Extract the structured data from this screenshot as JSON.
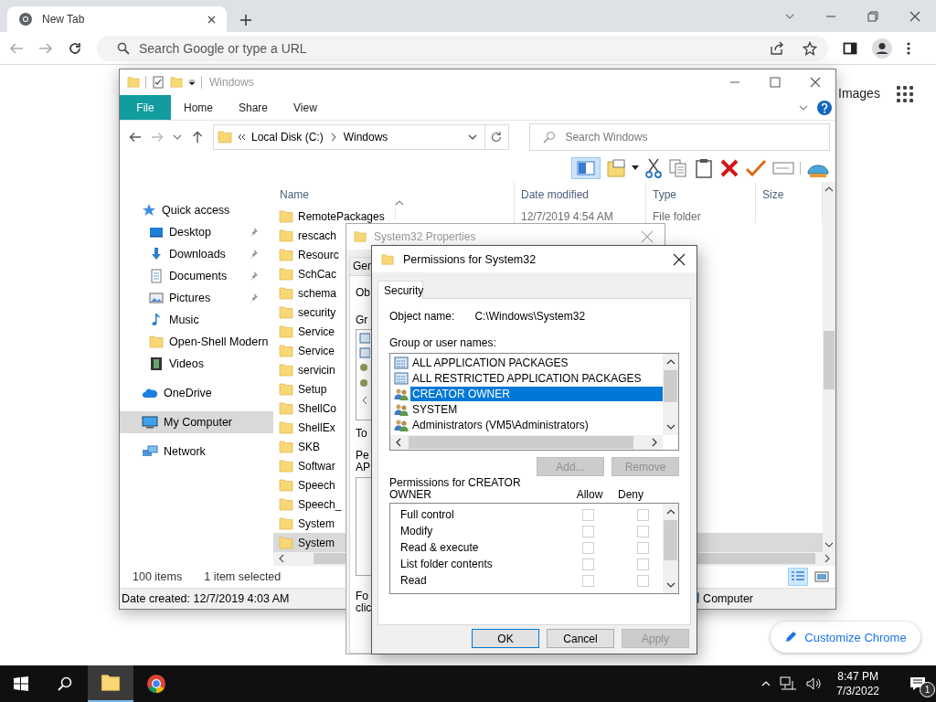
{
  "browser": {
    "tab": {
      "title": "New Tab"
    },
    "omnibox": {
      "placeholder": "Search Google or type a URL"
    },
    "header_link": "Images",
    "customize_button": "Customize Chrome"
  },
  "explorer": {
    "title": "Windows",
    "ribbon_tabs": [
      {
        "label": "File",
        "kind": "file"
      },
      {
        "label": "Home",
        "kind": "tab"
      },
      {
        "label": "Share",
        "kind": "tab"
      },
      {
        "label": "View",
        "kind": "tab"
      }
    ],
    "breadcrumb": [
      "Local Disk (C:)",
      "Windows"
    ],
    "search": {
      "placeholder": "Search Windows"
    },
    "nav": [
      {
        "label": "Quick access",
        "kind": "star",
        "pinned": false,
        "selected": false
      },
      {
        "label": "Desktop",
        "kind": "desktop",
        "pinned": true,
        "selected": false
      },
      {
        "label": "Downloads",
        "kind": "download",
        "pinned": true,
        "selected": false
      },
      {
        "label": "Documents",
        "kind": "document",
        "pinned": true,
        "selected": false
      },
      {
        "label": "Pictures",
        "kind": "picture",
        "pinned": true,
        "selected": false
      },
      {
        "label": "Music",
        "kind": "music",
        "pinned": false,
        "selected": false
      },
      {
        "label": "Open-Shell Modern",
        "kind": "folder",
        "pinned": false,
        "selected": false
      },
      {
        "label": "Videos",
        "kind": "video",
        "pinned": false,
        "selected": false
      },
      {
        "label": "OneDrive",
        "kind": "cloud",
        "pinned": false,
        "selected": false
      },
      {
        "label": "My Computer",
        "kind": "computer",
        "pinned": false,
        "selected": true
      },
      {
        "label": "Network",
        "kind": "network",
        "pinned": false,
        "selected": false
      }
    ],
    "columns": [
      "Name",
      "Date modified",
      "Type",
      "Size"
    ],
    "rows": [
      {
        "name": "RemotePackages",
        "date": "12/7/2019 4:54 AM",
        "type": "File folder",
        "selected": false
      },
      {
        "name": "rescach",
        "selected": false
      },
      {
        "name": "Resourc",
        "selected": false
      },
      {
        "name": "SchCac",
        "selected": false
      },
      {
        "name": "schema",
        "selected": false
      },
      {
        "name": "security",
        "selected": false
      },
      {
        "name": "Service",
        "selected": false
      },
      {
        "name": "Service",
        "selected": false
      },
      {
        "name": "servicin",
        "selected": false
      },
      {
        "name": "Setup",
        "selected": false
      },
      {
        "name": "ShellCo",
        "selected": false
      },
      {
        "name": "ShellEx",
        "selected": false
      },
      {
        "name": "SKB",
        "selected": false
      },
      {
        "name": "Softwar",
        "selected": false
      },
      {
        "name": "Speech",
        "selected": false
      },
      {
        "name": "Speech_",
        "selected": false
      },
      {
        "name": "System",
        "selected": false
      },
      {
        "name": "System",
        "selected": true
      }
    ],
    "item_count": "100 items",
    "selection_count": "1 item selected",
    "details": {
      "date_created": "Date created: 12/7/2019 4:03 AM",
      "location": "Computer"
    }
  },
  "properties": {
    "title": "System32 Properties",
    "tab": "Gen",
    "object_label": "Ob",
    "group_label": "Gr",
    "to_label": "To",
    "perm_label": [
      "Pe",
      "AP"
    ],
    "footer_label": [
      "Fo",
      "clic"
    ]
  },
  "permissions": {
    "title": "Permissions for System32",
    "tab": "Security",
    "object_name_label": "Object name:",
    "object_name": "C:\\Windows\\System32",
    "group_label": "Group or user names:",
    "groups": [
      {
        "name": "ALL APPLICATION PACKAGES",
        "kind": "package",
        "selected": false
      },
      {
        "name": "ALL RESTRICTED APPLICATION PACKAGES",
        "kind": "package",
        "selected": false
      },
      {
        "name": "CREATOR OWNER",
        "kind": "users",
        "selected": true
      },
      {
        "name": "SYSTEM",
        "kind": "users",
        "selected": false
      },
      {
        "name": "Administrators (VM5\\Administrators)",
        "kind": "users",
        "selected": false
      }
    ],
    "group_buttons": [
      {
        "label": "Add...",
        "disabled": true
      },
      {
        "label": "Remove",
        "disabled": true
      }
    ],
    "entries_label": "Permissions for CREATOR OWNER",
    "allow_header": "Allow",
    "deny_header": "Deny",
    "entries": [
      {
        "name": "Full control",
        "allow": false,
        "deny": false
      },
      {
        "name": "Modify",
        "allow": false,
        "deny": false
      },
      {
        "name": "Read & execute",
        "allow": false,
        "deny": false
      },
      {
        "name": "List folder contents",
        "allow": false,
        "deny": false
      },
      {
        "name": "Read",
        "allow": false,
        "deny": false
      }
    ],
    "buttons": [
      {
        "label": "OK",
        "default": true,
        "disabled": false
      },
      {
        "label": "Cancel",
        "default": false,
        "disabled": false
      },
      {
        "label": "Apply",
        "default": false,
        "disabled": true
      }
    ]
  },
  "taskbar": {
    "apps": [
      {
        "kind": "explorer",
        "active": true
      },
      {
        "kind": "chrome",
        "active": false
      }
    ],
    "time": "8:47 PM",
    "date": "7/3/2022",
    "notification_count": "1"
  }
}
